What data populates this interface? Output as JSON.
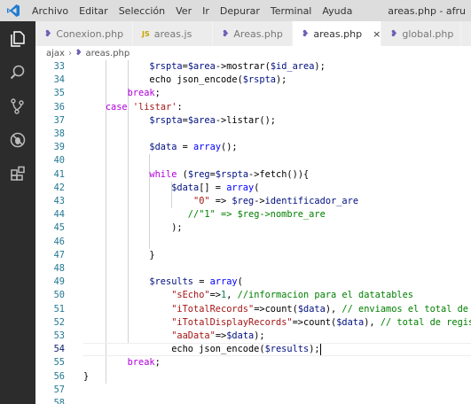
{
  "menu": [
    "Archivo",
    "Editar",
    "Selección",
    "Ver",
    "Ir",
    "Depurar",
    "Terminal",
    "Ayuda"
  ],
  "window_title": "areas.php - afru",
  "tabs": [
    {
      "label": "Conexion.php",
      "icon": "php-icon",
      "active": false
    },
    {
      "label": "areas.js",
      "icon": "js-icon",
      "active": false
    },
    {
      "label": "Areas.php",
      "icon": "php-icon",
      "active": false
    },
    {
      "label": "areas.php",
      "icon": "php-icon",
      "active": true,
      "close": "×"
    },
    {
      "label": "global.php",
      "icon": "php-icon",
      "active": false
    }
  ],
  "breadcrumb": {
    "folder": "ajax",
    "separator": "›",
    "file": "areas.php"
  },
  "activity_icons": [
    "explorer-icon",
    "search-icon",
    "source-control-icon",
    "debug-icon",
    "extensions-icon"
  ],
  "current_line": 54,
  "lines": [
    {
      "n": "33",
      "code": [
        [
          "t",
          "            "
        ],
        [
          "v",
          "$rspta"
        ],
        [
          "t",
          "="
        ],
        [
          "v",
          "$area"
        ],
        [
          "t",
          "->mostrar("
        ],
        [
          "v",
          "$id_area"
        ],
        [
          "t",
          ");"
        ]
      ]
    },
    {
      "n": "34",
      "code": [
        [
          "t",
          "            echo json_encode("
        ],
        [
          "v",
          "$rspta"
        ],
        [
          "t",
          ");"
        ]
      ]
    },
    {
      "n": "35",
      "code": [
        [
          "t",
          "        "
        ],
        [
          "c",
          "break"
        ],
        [
          "t",
          ";"
        ]
      ]
    },
    {
      "n": "36",
      "code": [
        [
          "t",
          "    "
        ],
        [
          "c",
          "case"
        ],
        [
          "t",
          " "
        ],
        [
          "s",
          "'listar'"
        ],
        [
          "t",
          ":"
        ]
      ]
    },
    {
      "n": "37",
      "code": [
        [
          "t",
          "            "
        ],
        [
          "v",
          "$rspta"
        ],
        [
          "t",
          "="
        ],
        [
          "v",
          "$area"
        ],
        [
          "t",
          "->listar();"
        ]
      ]
    },
    {
      "n": "38",
      "code": []
    },
    {
      "n": "39",
      "code": [
        [
          "t",
          "            "
        ],
        [
          "v",
          "$data"
        ],
        [
          "t",
          " = "
        ],
        [
          "k",
          "array"
        ],
        [
          "t",
          "();"
        ]
      ]
    },
    {
      "n": "40",
      "code": []
    },
    {
      "n": "41",
      "code": [
        [
          "t",
          "            "
        ],
        [
          "c",
          "while"
        ],
        [
          "t",
          " ("
        ],
        [
          "v",
          "$reg"
        ],
        [
          "t",
          "="
        ],
        [
          "v",
          "$rspta"
        ],
        [
          "t",
          "->fetch()){"
        ]
      ]
    },
    {
      "n": "42",
      "code": [
        [
          "t",
          "                "
        ],
        [
          "v",
          "$data"
        ],
        [
          "t",
          "[] = "
        ],
        [
          "k",
          "array"
        ],
        [
          "t",
          "("
        ]
      ]
    },
    {
      "n": "43",
      "code": [
        [
          "t",
          "                    "
        ],
        [
          "s",
          "\"0\""
        ],
        [
          "t",
          " => "
        ],
        [
          "v",
          "$reg"
        ],
        [
          "t",
          "->"
        ],
        [
          "v",
          "identificador_are"
        ]
      ]
    },
    {
      "n": "44",
      "code": [
        [
          "t",
          "                   "
        ],
        [
          "m",
          "//\"1\" => $reg->nombre_are"
        ]
      ]
    },
    {
      "n": "45",
      "code": [
        [
          "t",
          "                );"
        ]
      ]
    },
    {
      "n": "46",
      "code": []
    },
    {
      "n": "47",
      "code": [
        [
          "t",
          "            }"
        ]
      ]
    },
    {
      "n": "48",
      "code": []
    },
    {
      "n": "49",
      "code": [
        [
          "t",
          "            "
        ],
        [
          "v",
          "$results"
        ],
        [
          "t",
          " = "
        ],
        [
          "k",
          "array"
        ],
        [
          "t",
          "("
        ]
      ]
    },
    {
      "n": "50",
      "code": [
        [
          "t",
          "                "
        ],
        [
          "s",
          "\"sEcho\""
        ],
        [
          "t",
          "=>"
        ],
        [
          "n",
          "1"
        ],
        [
          "t",
          ", "
        ],
        [
          "m",
          "//informacion para el datatables"
        ]
      ]
    },
    {
      "n": "51",
      "code": [
        [
          "t",
          "                "
        ],
        [
          "s",
          "\"iTotalRecords\""
        ],
        [
          "t",
          "=>count("
        ],
        [
          "v",
          "$data"
        ],
        [
          "t",
          "), "
        ],
        [
          "m",
          "// enviamos el total de r"
        ]
      ]
    },
    {
      "n": "52",
      "code": [
        [
          "t",
          "                "
        ],
        [
          "s",
          "\"iTotalDisplayRecords\""
        ],
        [
          "t",
          "=>count("
        ],
        [
          "v",
          "$data"
        ],
        [
          "t",
          "), "
        ],
        [
          "m",
          "// total de regist"
        ]
      ]
    },
    {
      "n": "53",
      "code": [
        [
          "t",
          "                "
        ],
        [
          "s",
          "\"aaData\""
        ],
        [
          "t",
          "=>"
        ],
        [
          "v",
          "$data"
        ],
        [
          "t",
          ");"
        ]
      ]
    },
    {
      "n": "54",
      "code": [
        [
          "t",
          "                echo json_encode("
        ],
        [
          "v",
          "$results"
        ],
        [
          "t",
          ");"
        ]
      ]
    },
    {
      "n": "55",
      "code": [
        [
          "t",
          "        "
        ],
        [
          "c",
          "break"
        ],
        [
          "t",
          ";"
        ]
      ]
    },
    {
      "n": "56",
      "code": [
        [
          "t",
          "}"
        ]
      ]
    },
    {
      "n": "57",
      "code": []
    },
    {
      "n": "58",
      "code": []
    }
  ],
  "colors": {
    "keyword": "#0000ff",
    "control": "#af00db",
    "string": "#a31515",
    "number": "#098658",
    "comment": "#008000",
    "variable": "#001080",
    "line_number": "#237893",
    "activity_bar": "#2c2c2c"
  }
}
